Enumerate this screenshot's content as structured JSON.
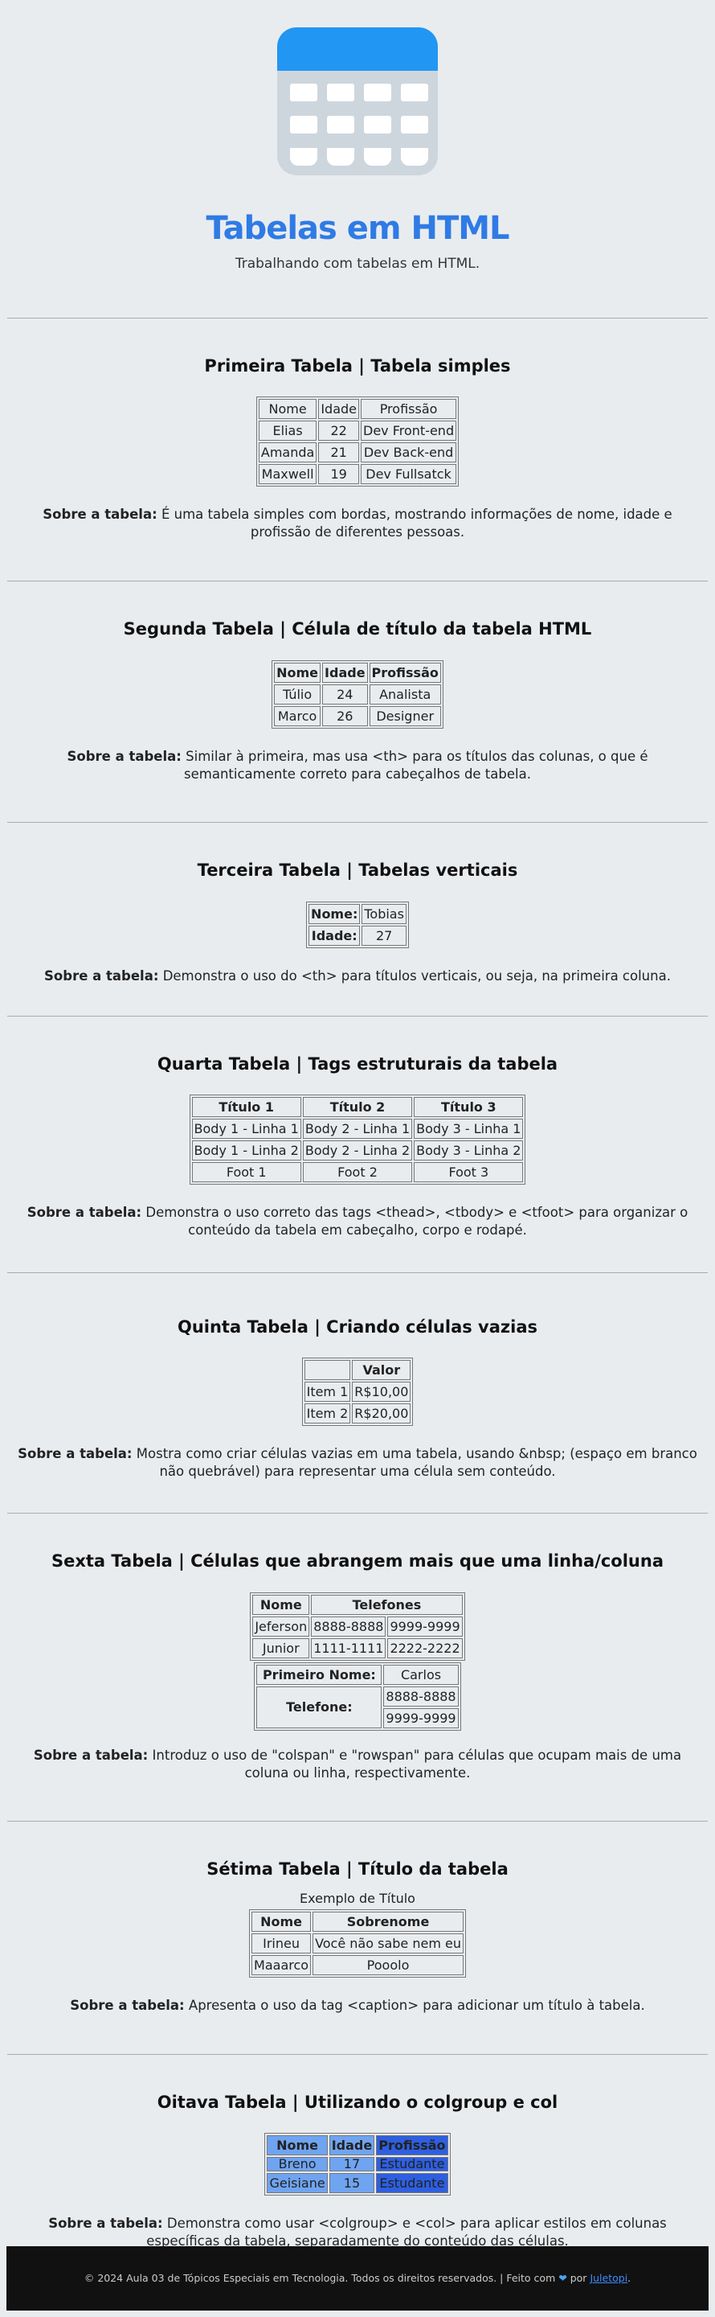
{
  "header": {
    "title": "Tabelas em HTML",
    "subtitle": "Trabalhando com tabelas em HTML."
  },
  "about_label": "Sobre a tabela:",
  "t1": {
    "heading": "Primeira Tabela | Tabela simples",
    "rows": [
      [
        "Nome",
        "Idade",
        "Profissão"
      ],
      [
        "Elias",
        "22",
        "Dev Front-end"
      ],
      [
        "Amanda",
        "21",
        "Dev Back-end"
      ],
      [
        "Maxwell",
        "19",
        "Dev Fullsatck"
      ]
    ],
    "about": "É uma tabela simples com bordas, mostrando informações de nome, idade e profissão de diferentes pessoas."
  },
  "t2": {
    "heading": "Segunda Tabela | Célula de título da tabela HTML",
    "headers": [
      "Nome",
      "Idade",
      "Profissão"
    ],
    "rows": [
      [
        "Túlio",
        "24",
        "Analista"
      ],
      [
        "Marco",
        "26",
        "Designer"
      ]
    ],
    "about": "Similar à primeira, mas usa <th> para os títulos das colunas, o que é semanticamente correto para cabeçalhos de tabela."
  },
  "t3": {
    "heading": "Terceira Tabela | Tabelas verticais",
    "rows": [
      [
        "Nome:",
        "Tobias"
      ],
      [
        "Idade:",
        "27"
      ]
    ],
    "about": "Demonstra o uso do <th> para títulos verticais, ou seja, na primeira coluna."
  },
  "t4": {
    "heading": "Quarta Tabela | Tags estruturais da tabela",
    "headers": [
      "Título 1",
      "Título 2",
      "Título 3"
    ],
    "rows": [
      [
        "Body 1 - Linha 1",
        "Body 2 - Linha 1",
        "Body 3 - Linha 1"
      ],
      [
        "Body 1 - Linha 2",
        "Body 2 - Linha 2",
        "Body 3 - Linha 2"
      ]
    ],
    "foot": [
      "Foot 1",
      "Foot 2",
      "Foot 3"
    ],
    "about": "Demonstra o uso correto das tags <thead>, <tbody> e <tfoot> para organizar o conteúdo da tabela em cabeçalho, corpo e rodapé."
  },
  "t5": {
    "heading": "Quinta Tabela | Criando células vazias",
    "header": "Valor",
    "rows": [
      [
        "Item 1",
        "R$10,00"
      ],
      [
        "Item 2",
        "R$20,00"
      ]
    ],
    "about": "Mostra como criar células vazias em uma tabela, usando &nbsp; (espaço em branco não quebrável) para representar uma célula sem conteúdo."
  },
  "t6": {
    "heading": "Sexta Tabela | Células que abrangem mais que uma linha/coluna",
    "a_headers": [
      "Nome",
      "Telefones"
    ],
    "a_rows": [
      [
        "Jeferson",
        "8888-8888",
        "9999-9999"
      ],
      [
        "Junior",
        "1111-1111",
        "2222-2222"
      ]
    ],
    "b_label1": "Primeiro Nome:",
    "b_value1": "Carlos",
    "b_label2": "Telefone:",
    "b_phones": [
      "8888-8888",
      "9999-9999"
    ],
    "about": "Introduz o uso de \"colspan\" e \"rowspan\" para células que ocupam mais de uma coluna ou linha, respectivamente."
  },
  "t7": {
    "heading": "Sétima Tabela | Título da tabela",
    "caption": "Exemplo de Título",
    "headers": [
      "Nome",
      "Sobrenome"
    ],
    "rows": [
      [
        "Irineu",
        "Você não sabe nem eu"
      ],
      [
        "Maaarco",
        "Pooolo"
      ]
    ],
    "about": "Apresenta o uso da tag <caption> para adicionar um título à tabela."
  },
  "t8": {
    "heading": "Oitava Tabela | Utilizando o colgroup e col",
    "headers": [
      "Nome",
      "Idade",
      "Profissão"
    ],
    "rows": [
      [
        "Breno",
        "17",
        "Estudante"
      ],
      [
        "Geisiane",
        "15",
        "Estudante"
      ]
    ],
    "about": "Demonstra como usar <colgroup> e <col> para aplicar estilos em colunas específicas da tabela, separadamente do conteúdo das células."
  },
  "footer": {
    "text": "© 2024 Aula 03 de Tópicos Especiais em Tecnologia. Todos os direitos reservados. | Feito com",
    "by": "por",
    "author": "Juletopi",
    "end": "."
  },
  "colors": {
    "title": "#2f7be5",
    "calendar_top": "#2196f3",
    "calendar_body": "#ced6dd",
    "col_light": "#6fa4f0",
    "col_strong": "#2e5fe0"
  },
  "icons": [
    "calendar-icon",
    "heart-icon"
  ]
}
